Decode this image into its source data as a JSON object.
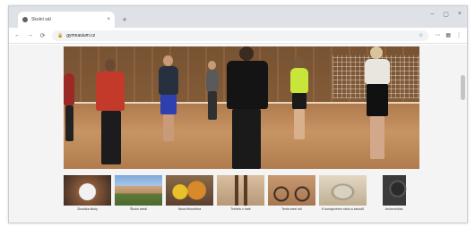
{
  "browser": {
    "tab_title": "Školní sál",
    "tab_close_glyph": "×",
    "newtab_glyph": "+",
    "window_controls": [
      "–",
      "▢",
      "×"
    ],
    "nav": {
      "back": "←",
      "forward": "→",
      "reload": "⟳"
    },
    "url": "gymnasium.cz",
    "lock_glyph": "🔒",
    "star_glyph": "☆",
    "toolbar_icons": [
      "⋯",
      "▦",
      "⋮"
    ]
  },
  "gallery": {
    "thumbnails": [
      {
        "caption": "Zkouška školy",
        "icon": "ball-photo"
      },
      {
        "caption": "Školní areál",
        "icon": "building-photo"
      },
      {
        "caption": "Nová tělocvična",
        "icon": "sport-balls-photo"
      },
      {
        "caption": "Trénink v hale",
        "icon": "gym-equipment-photo"
      },
      {
        "caption": "Tenis mezi sítí",
        "icon": "bicycle-photo"
      },
      {
        "caption": "K turnajovému stolu a závodů",
        "icon": "trophy-photo"
      },
      {
        "caption": "Archeoložka",
        "icon": "camera-photo"
      }
    ]
  },
  "colors": {
    "tabstrip": "#dee1e6",
    "omnibox": "#f1f3f4",
    "page_bg": "#f4f4f4"
  }
}
